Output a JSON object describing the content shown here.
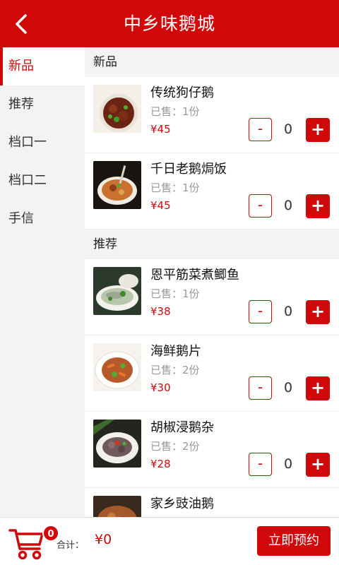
{
  "header": {
    "title": "中乡味鹅城",
    "back_icon": "chevron-left-icon"
  },
  "sidebar": {
    "items": [
      {
        "label": "新品",
        "active": true
      },
      {
        "label": "推荐"
      },
      {
        "label": "档口一"
      },
      {
        "label": "档口二"
      },
      {
        "label": "手信"
      }
    ]
  },
  "sections": [
    {
      "title": "新品",
      "items": [
        {
          "name": "传统狗仔鹅",
          "sold": "已售：1份",
          "price": "¥45",
          "qty": "0",
          "minus": "-",
          "plus": "+"
        },
        {
          "name": "千日老鹅焗饭",
          "sold": "已售：1份",
          "price": "¥45",
          "qty": "0",
          "minus": "-",
          "plus": "+"
        }
      ]
    },
    {
      "title": "推荐",
      "items": [
        {
          "name": "恩平筋菜煮鲫鱼",
          "sold": "已售：1份",
          "price": "¥38",
          "qty": "0",
          "minus": "-",
          "plus": "+"
        },
        {
          "name": "海鲜鹅片",
          "sold": "已售：2份",
          "price": "¥30",
          "qty": "0",
          "minus": "-",
          "plus": "+"
        },
        {
          "name": "胡椒浸鹅杂",
          "sold": "已售：2份",
          "price": "¥28",
          "qty": "0",
          "minus": "-",
          "plus": "+"
        },
        {
          "name": "家乡豉油鹅",
          "sold": "",
          "price": "",
          "qty": "",
          "minus": "",
          "plus": ""
        }
      ]
    }
  ],
  "bottom": {
    "cart_badge": "0",
    "total_label": "合计：",
    "total_value": "¥0",
    "reserve_label": "立即预约"
  },
  "colors": {
    "accent": "#d0080a",
    "sidebar_bg": "#f3f3f3",
    "muted": "#999999"
  }
}
